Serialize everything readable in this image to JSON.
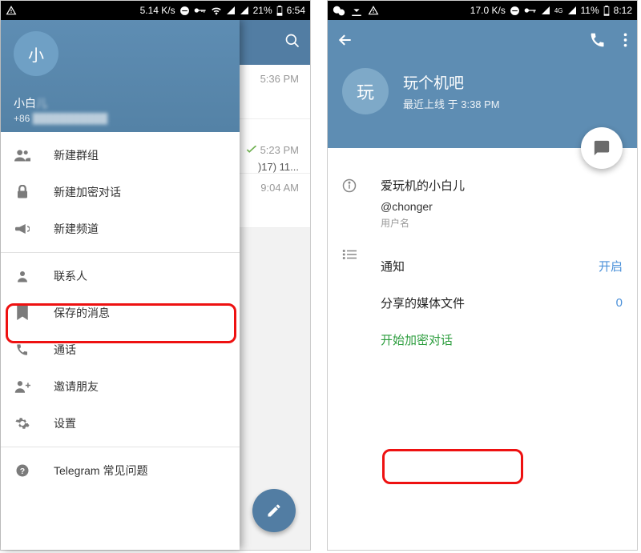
{
  "left": {
    "statusbar": {
      "net": "5.14 K/s",
      "battery": "21%",
      "time": "6:54"
    },
    "chat": {
      "rows": [
        {
          "time": "5:36 PM",
          "check": false
        },
        {
          "time": "5:23 PM",
          "check": true,
          "extra": ")17) 11..."
        },
        {
          "time": "9:04 AM",
          "check": false
        }
      ]
    },
    "drawer": {
      "avatar_text": "小",
      "name": "小白",
      "phone": "+86",
      "items": {
        "new_group": "新建群组",
        "new_secret": "新建加密对话",
        "new_channel": "新建频道",
        "contacts": "联系人",
        "saved": "保存的消息",
        "calls": "通话",
        "invite": "邀请朋友",
        "settings": "设置",
        "faq": "Telegram 常见问题"
      }
    }
  },
  "right": {
    "statusbar": {
      "net": "17.0 K/s",
      "battery": "11%",
      "time": "8:12",
      "signal": "4G"
    },
    "profile": {
      "avatar_text": "玩",
      "name": "玩个机吧",
      "last_seen": "最近上线 于 3:38 PM"
    },
    "info": {
      "title": "爱玩机的小白儿",
      "username": "@chonger",
      "username_hint": "用户名",
      "notifications_label": "通知",
      "notifications_value": "开启",
      "shared_media_label": "分享的媒体文件",
      "shared_media_value": "0",
      "start_secret": "开始加密对话"
    }
  }
}
